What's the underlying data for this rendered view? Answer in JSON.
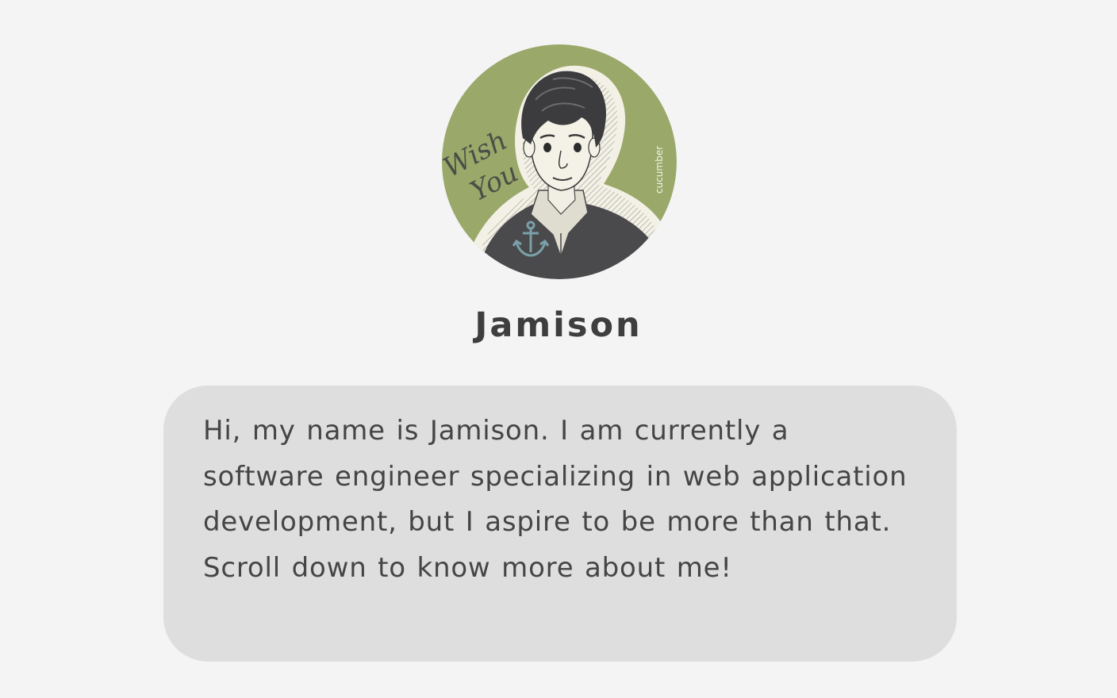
{
  "profile": {
    "avatar_caption": "Wish You",
    "avatar_signature": "cucumber",
    "name": "Jamison",
    "bio": "Hi, my name is Jamison. I am currently a software engineer specializing in web application development, but I aspire to be more than that. Scroll down to know more about me!"
  },
  "colors": {
    "background": "#f4f4f4",
    "avatar_ring": "#9aa86a",
    "card": "#dedede",
    "text": "#454545",
    "anchor": "#7aa0a8"
  },
  "icons": {
    "avatar_emblem": "anchor-icon"
  }
}
